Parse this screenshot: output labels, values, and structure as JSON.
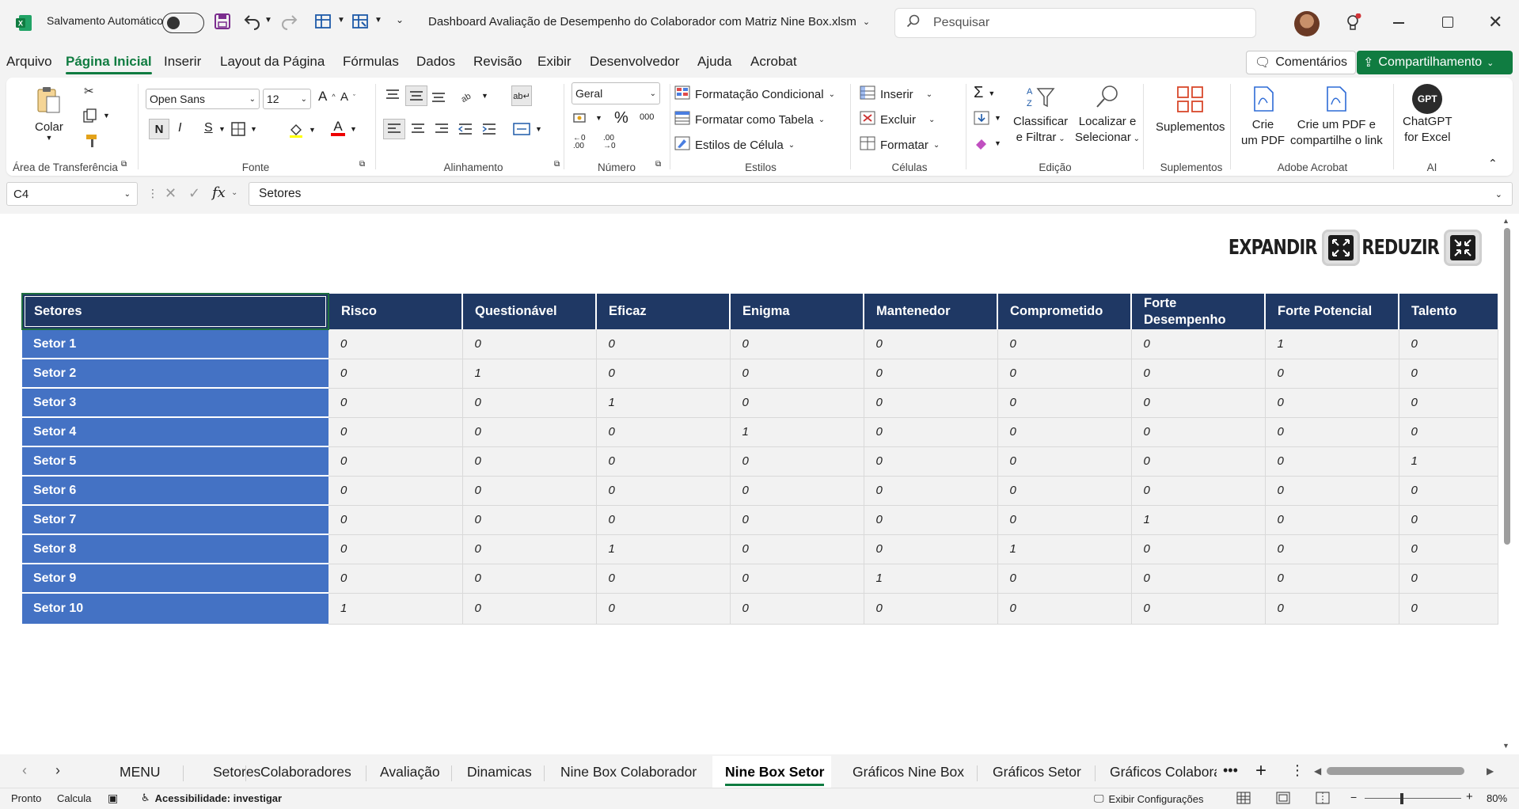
{
  "titlebar": {
    "autosave_label": "Salvamento Automático",
    "filename": "Dashboard Avaliação de Desempenho do Colaborador com Matriz Nine Box.xlsm",
    "search_placeholder": "Pesquisar"
  },
  "menu_tabs": [
    "Arquivo",
    "Página Inicial",
    "Inserir",
    "Layout da Página",
    "Fórmulas",
    "Dados",
    "Revisão",
    "Exibir",
    "Desenvolvedor",
    "Ajuda",
    "Acrobat"
  ],
  "top_buttons": {
    "comments": "Comentários",
    "share": "Compartilhamento"
  },
  "ribbon": {
    "clipboard": {
      "paste": "Colar",
      "label": "Área de Transferência"
    },
    "font": {
      "name": "Open Sans",
      "size": "12",
      "bold": "N",
      "italic": "I",
      "underline": "S",
      "label": "Fonte"
    },
    "alignment": {
      "label": "Alinhamento"
    },
    "number": {
      "format": "Geral",
      "label": "Número"
    },
    "styles": {
      "conditional": "Formatação Condicional",
      "as_table": "Formatar como Tabela",
      "cell_styles": "Estilos de Célula",
      "label": "Estilos"
    },
    "cells": {
      "insert": "Inserir",
      "delete": "Excluir",
      "format": "Formatar",
      "label": "Células"
    },
    "editing": {
      "sort1": "Classificar",
      "sort2": "e Filtrar",
      "find1": "Localizar e",
      "find2": "Selecionar",
      "label": "Edição"
    },
    "addins": {
      "btn": "Suplementos",
      "label": "Suplementos"
    },
    "acrobat": {
      "pdf1": "Crie",
      "pdf2": "um PDF",
      "share1": "Crie um PDF e",
      "share2": "compartilhe o link",
      "label": "Adobe Acrobat"
    },
    "ai": {
      "logo": "GPT",
      "btn1": "ChatGPT",
      "btn2": "for Excel",
      "label": "AI"
    }
  },
  "formula_bar": {
    "name_box": "C4",
    "fx": "fx",
    "content": "Setores"
  },
  "sheet": {
    "expand_label": "EXPANDIR",
    "reduce_label": "REDUZIR",
    "headers": [
      "Setores",
      "Risco",
      "Questionável",
      "Eficaz",
      "Enigma",
      "Mantenedor",
      "Comprometido",
      "Forte Desempenho",
      "Forte Potencial",
      "Talento"
    ],
    "rows": [
      {
        "name": "Setor 1",
        "values": [
          "0",
          "0",
          "0",
          "0",
          "0",
          "0",
          "0",
          "1",
          "0"
        ]
      },
      {
        "name": "Setor 2",
        "values": [
          "0",
          "1",
          "0",
          "0",
          "0",
          "0",
          "0",
          "0",
          "0"
        ]
      },
      {
        "name": "Setor 3",
        "values": [
          "0",
          "0",
          "1",
          "0",
          "0",
          "0",
          "0",
          "0",
          "0"
        ]
      },
      {
        "name": "Setor 4",
        "values": [
          "0",
          "0",
          "0",
          "1",
          "0",
          "0",
          "0",
          "0",
          "0"
        ]
      },
      {
        "name": "Setor 5",
        "values": [
          "0",
          "0",
          "0",
          "0",
          "0",
          "0",
          "0",
          "0",
          "1"
        ]
      },
      {
        "name": "Setor 6",
        "values": [
          "0",
          "0",
          "0",
          "0",
          "0",
          "0",
          "0",
          "0",
          "0"
        ]
      },
      {
        "name": "Setor 7",
        "values": [
          "0",
          "0",
          "0",
          "0",
          "0",
          "0",
          "1",
          "0",
          "0"
        ]
      },
      {
        "name": "Setor 8",
        "values": [
          "0",
          "0",
          "1",
          "0",
          "0",
          "1",
          "0",
          "0",
          "0"
        ]
      },
      {
        "name": "Setor 9",
        "values": [
          "0",
          "0",
          "0",
          "0",
          "1",
          "0",
          "0",
          "0",
          "0"
        ]
      },
      {
        "name": "Setor 10",
        "values": [
          "1",
          "0",
          "0",
          "0",
          "0",
          "0",
          "0",
          "0",
          "0"
        ]
      }
    ]
  },
  "sheet_tabs": [
    "MENU",
    "Setores",
    "Colaboradores",
    "Avaliação",
    "Dinamicas",
    "Nine Box Colaborador",
    "Nine Box Setor",
    "Gráficos Nine Box",
    "Gráficos Setor",
    "Gráficos Colabora"
  ],
  "active_sheet": "Nine Box Setor",
  "status": {
    "ready": "Pronto",
    "calc": "Calcula",
    "accessibility": "Acessibilidade: investigar",
    "display": "Exibir Configurações",
    "zoom": "80%"
  },
  "colors": {
    "header_bg": "#1f3864",
    "row_label_bg": "#4472c4",
    "cell_bg": "#f2f2f2",
    "accent": "#107c41"
  }
}
